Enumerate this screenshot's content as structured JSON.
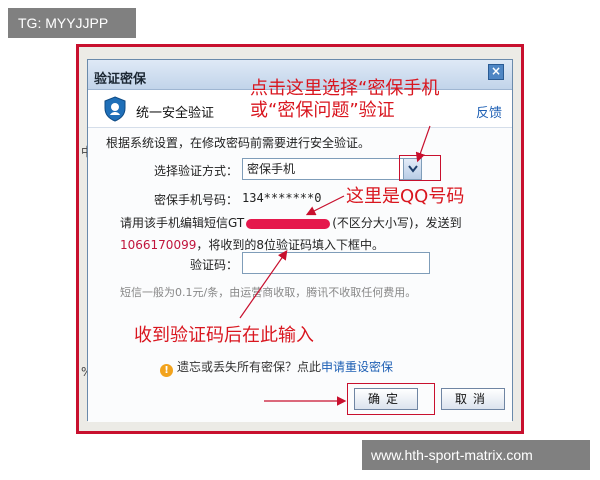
{
  "tag_label": "TG: MYYJJPP",
  "watermark": "www.hth-sport-matrix.com",
  "behind": {
    "left_char_1": "中",
    "left_char_2": "%"
  },
  "dialog": {
    "title": "验证密保",
    "close_label": "×",
    "security_title": "统一安全验证",
    "feedback_link": "反馈",
    "description": "根据系统设置，在修改密码前需要进行安全验证。",
    "method_label": "选择验证方式：",
    "method_value": "密保手机",
    "phone_label": "密保手机号码：",
    "phone_value": "134*******0",
    "sms_line1_prefix": "请用该手机编辑短信GT",
    "sms_line1_suffix": "(不区分大小写)，发送到",
    "sms_number": "1066170099",
    "sms_line2_suffix": "，将收到的8位验证码填入下框中。",
    "code_label": "验证码：",
    "code_placeholder": "",
    "fee_note": "短信一般为0.1元/条，由运营商收取，腾讯不收取任何费用。",
    "forgot_text": "遗忘或丢失所有密保？点此",
    "reset_link": "申请重设密保",
    "ok_button": "确定",
    "cancel_button": "取消"
  },
  "annotations": {
    "choose_line1": "点击这里选择“密保手机",
    "choose_line2": "或“密保问题”验证",
    "qq_number": "这里是QQ号码",
    "enter_code": "收到验证码后在此输入"
  },
  "colors": {
    "annotation": "#d9161f",
    "link": "#1d5fb4",
    "frame": "#c8102e"
  }
}
